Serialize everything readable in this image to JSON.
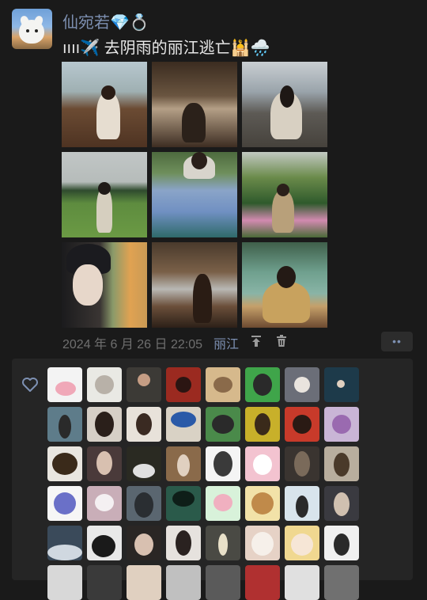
{
  "post": {
    "username": "仙宛若💎💍",
    "caption": "ıııı✈️ 去阴雨的丽江逃亡🕌🌧️",
    "date": "2024 年 6 月 26 日 22:05",
    "location": "丽江",
    "more_label": "••"
  },
  "icons": {
    "avatar": "user-avatar",
    "top": "pin-top-icon",
    "delete": "trash-icon",
    "like": "heart-icon"
  },
  "photos_count": 9,
  "likes_avatar_count": 48,
  "colors": {
    "background": "#1a1a1a",
    "name_blue": "#7d90b2",
    "likes_panel": "#252525",
    "meta_gray": "#6f6f6f"
  }
}
